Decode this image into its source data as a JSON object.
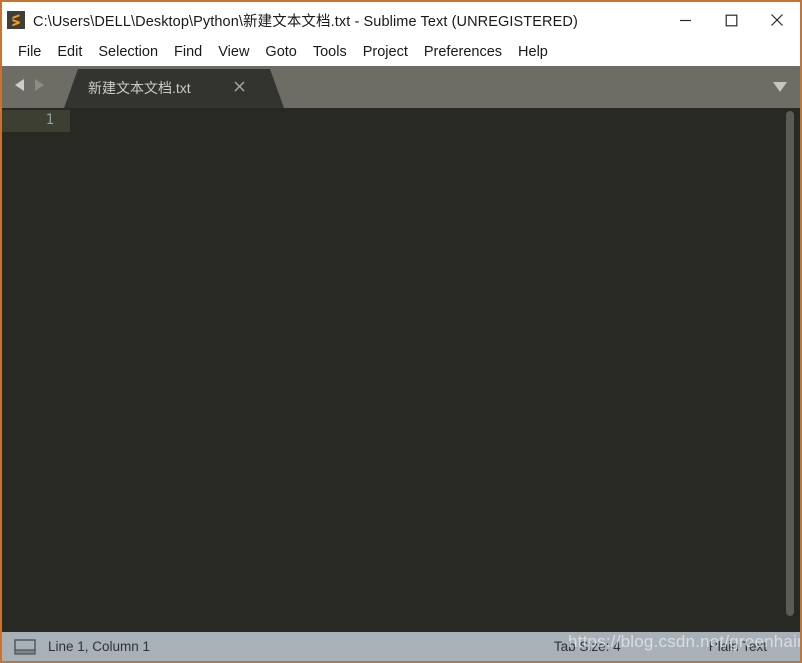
{
  "window": {
    "title": "C:\\Users\\DELL\\Desktop\\Python\\新建文本文档.txt - Sublime Text (UNREGISTERED)",
    "app_icon": "sublime-text-icon",
    "border_color": "#c0763a",
    "titlebar_bg": "#ffffff",
    "controls": {
      "minimize_label": "—",
      "maximize_label": "□",
      "close_label": "✕"
    }
  },
  "menubar": {
    "items": [
      {
        "label": "File"
      },
      {
        "label": "Edit"
      },
      {
        "label": "Selection"
      },
      {
        "label": "Find"
      },
      {
        "label": "View"
      },
      {
        "label": "Goto"
      },
      {
        "label": "Tools"
      },
      {
        "label": "Project"
      },
      {
        "label": "Preferences"
      },
      {
        "label": "Help"
      }
    ]
  },
  "tabbar": {
    "bg_color": "#6d6d66",
    "nav_back_icon": "arrow-left-icon",
    "nav_forward_icon": "arrow-right-icon",
    "tabs_menu_icon": "chevron-down-icon",
    "tabs": [
      {
        "label": "新建文本文档.txt",
        "active": true,
        "close_icon": "close-icon"
      }
    ]
  },
  "editor": {
    "bg_color": "#282923",
    "content": "",
    "gutter": {
      "line_numbers": [
        "1"
      ],
      "current_line_highlight_color": "#3e3f33",
      "line_number_color": "#90a0a8"
    },
    "scrollbar": {
      "thumb_color": "#5a5b53"
    }
  },
  "statusbar": {
    "bg_color": "#a8b0b8",
    "sidebar_toggle_icon": "panel-icon",
    "cursor_position": "Line 1, Column 1",
    "tab_size": "Tab Size: 4",
    "syntax": "Plain Text"
  },
  "watermark": {
    "text": "https://blog.csdn.net/greenhair"
  }
}
